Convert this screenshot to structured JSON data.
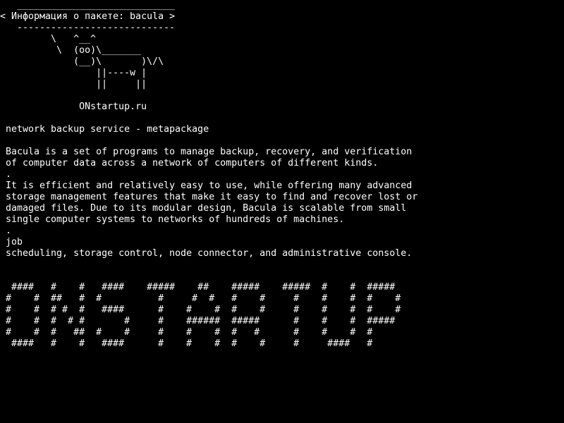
{
  "screen": {
    "background": "#000000",
    "foreground": "#ffffff"
  },
  "cowsay": {
    "bubble_top": "  ____________________________",
    "bubble_text": "< Информация о пакете: bacula >",
    "bubble_bottom": "  ----------------------------",
    "cow_1": "        \\   ^__^",
    "cow_2": "         \\  (oo)\\_______",
    "cow_3": "            (__)\\       )\\/\\",
    "cow_4": "                ||----w |",
    "cow_5": "                ||     ||",
    "site": "             ONstartup.ru"
  },
  "package": {
    "summary": "network backup service - metapackage",
    "desc_line_1": "Bacula is a set of programs to manage backup, recovery, and verification",
    "desc_line_2": "of computer data across a network of computers of different kinds.",
    "separator_1": ".",
    "desc_line_3": "It is efficient and relatively easy to use, while offering many advanced",
    "desc_line_4": "storage management features that make it easy to find and recover lost or",
    "desc_line_5": "damaged files. Due to its modular design, Bacula is scalable from small",
    "desc_line_6": "single computer systems to networks of hundreds of machines.",
    "separator_2": ".",
    "desc_line_7": "job",
    "desc_line_8": "scheduling, storage control, node connector, and administrative console."
  },
  "banner": {
    "row_1": " ####   #    #   ####    #####    ##    #####    #####  #    #  #####",
    "row_2": "#    #  ##   #  #          #     #  #   #    #     #    #    #  #    #",
    "row_3": "#    #  # #  #   ####      #    #    #  #    #     #    #    #  #    #",
    "row_4": "#    #  #  # #       #     #    ######  #####      #    #    #  #####",
    "row_5": "#    #  #   ##  #    #     #    #    #  #   #      #    #    #  #",
    "row_6": " ####   #    #   ####      #    #    #  #    #     #     ####   #"
  }
}
